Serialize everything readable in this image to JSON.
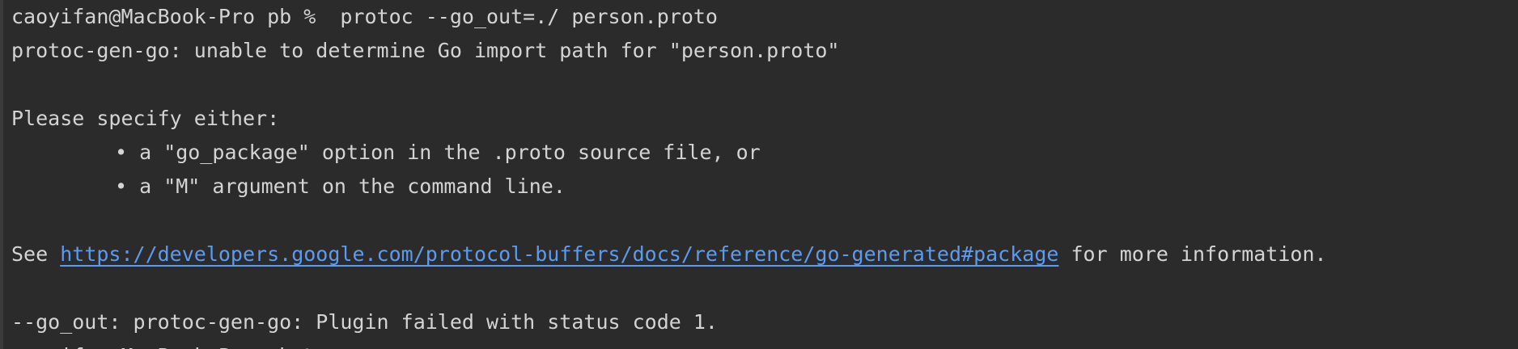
{
  "terminal": {
    "prompt_line": "caoyifan@MacBook-Pro pb %  protoc --go_out=./ person.proto",
    "error_line": "protoc-gen-go: unable to determine Go import path for \"person.proto\"",
    "specify_line": "Please specify either:",
    "bullets": [
      "• a \"go_package\" option in the .proto source file, or",
      "• a \"M\" argument on the command line."
    ],
    "see_prefix": "See ",
    "link_url": "https://developers.google.com/protocol-buffers/docs/reference/go-generated#package",
    "see_suffix": " for more information.",
    "failure_line": "--go_out: protoc-gen-go: Plugin failed with status code 1.",
    "next_prompt_partial": "caoyifan@MacBook-Pro pb %"
  },
  "colors": {
    "background": "#2b2b2c",
    "text": "#d4d4d4",
    "link": "#5b9bf0"
  }
}
